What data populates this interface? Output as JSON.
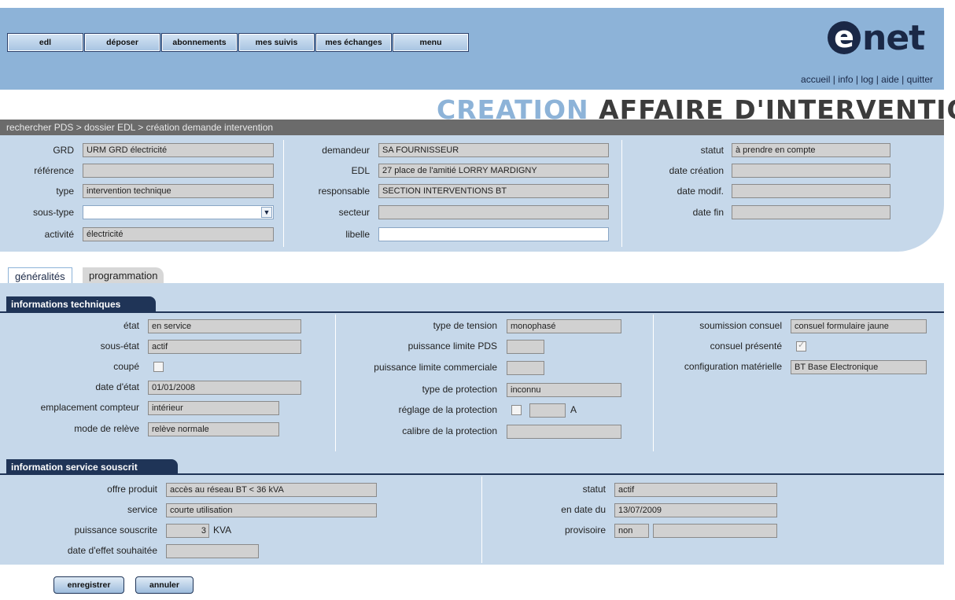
{
  "nav": [
    "edl",
    "déposer",
    "abonnements",
    "mes suivis",
    "mes échanges",
    "menu"
  ],
  "logo": {
    "letter": "e",
    "text": "net"
  },
  "toplinks": [
    "accueil",
    "info",
    "log",
    "aide",
    "quitter"
  ],
  "title": {
    "part1": "CREATION",
    "part2": "AFFAIRE D'INTERVENTION"
  },
  "breadcrumb": "rechercher PDS > dossier EDL > création demande intervention",
  "header": {
    "col1": [
      {
        "label": "GRD",
        "value": "URM GRD électricité"
      },
      {
        "label": "référence",
        "value": ""
      },
      {
        "label": "type",
        "value": "intervention technique"
      },
      {
        "label": "sous-type",
        "value": ""
      },
      {
        "label": "activité",
        "value": "électricité"
      }
    ],
    "col2": [
      {
        "label": "demandeur",
        "value": "SA FOURNISSEUR"
      },
      {
        "label": "EDL",
        "value": "27 place de l'amitié LORRY MARDIGNY"
      },
      {
        "label": "responsable",
        "value": "SECTION INTERVENTIONS BT"
      },
      {
        "label": "secteur",
        "value": ""
      },
      {
        "label": "libelle",
        "value": ""
      }
    ],
    "col3": [
      {
        "label": "statut",
        "value": "à prendre en compte"
      },
      {
        "label": "date création",
        "value": ""
      },
      {
        "label": "date modif.",
        "value": ""
      },
      {
        "label": "date fin",
        "value": ""
      }
    ]
  },
  "tabs": [
    "généralités",
    "programmation"
  ],
  "tech": {
    "title": "informations techniques",
    "col1": [
      {
        "label": "état",
        "value": "en service"
      },
      {
        "label": "sous-état",
        "value": "actif"
      },
      {
        "label": "coupé",
        "checkbox": false
      },
      {
        "label": "date d'état",
        "value": "01/01/2008"
      },
      {
        "label": "emplacement compteur",
        "value": "intérieur"
      },
      {
        "label": "mode de relève",
        "value": "relève normale"
      }
    ],
    "col2": [
      {
        "label": "type de tension",
        "value": "monophasé"
      },
      {
        "label": "puissance limite PDS",
        "value": ""
      },
      {
        "label": "puissance limite commerciale",
        "value": ""
      },
      {
        "label": "type de protection",
        "value": "inconnu"
      },
      {
        "label": "réglage de la protection",
        "value": "",
        "unit": "A"
      },
      {
        "label": "calibre de la protection",
        "value": ""
      }
    ],
    "col3": [
      {
        "label": "soumission consuel",
        "value": "consuel formulaire jaune"
      },
      {
        "label": "consuel présenté",
        "checkbox": true
      },
      {
        "label": "configuration matérielle",
        "value": "BT Base Electronique"
      }
    ]
  },
  "service": {
    "title": "information service souscrit",
    "col1": [
      {
        "label": "offre produit",
        "value": "accès au réseau BT < 36 kVA"
      },
      {
        "label": "service",
        "value": "courte utilisation"
      },
      {
        "label": "puissance souscrite",
        "value": "3",
        "unit": "KVA"
      },
      {
        "label": "date d'effet souhaitée",
        "value": ""
      }
    ],
    "col2": [
      {
        "label": "statut",
        "value": "actif"
      },
      {
        "label": "en date du",
        "value": "13/07/2009"
      },
      {
        "label": "provisoire",
        "value": "non",
        "value2": ""
      }
    ]
  },
  "buttons": {
    "save": "enregistrer",
    "cancel": "annuler"
  }
}
